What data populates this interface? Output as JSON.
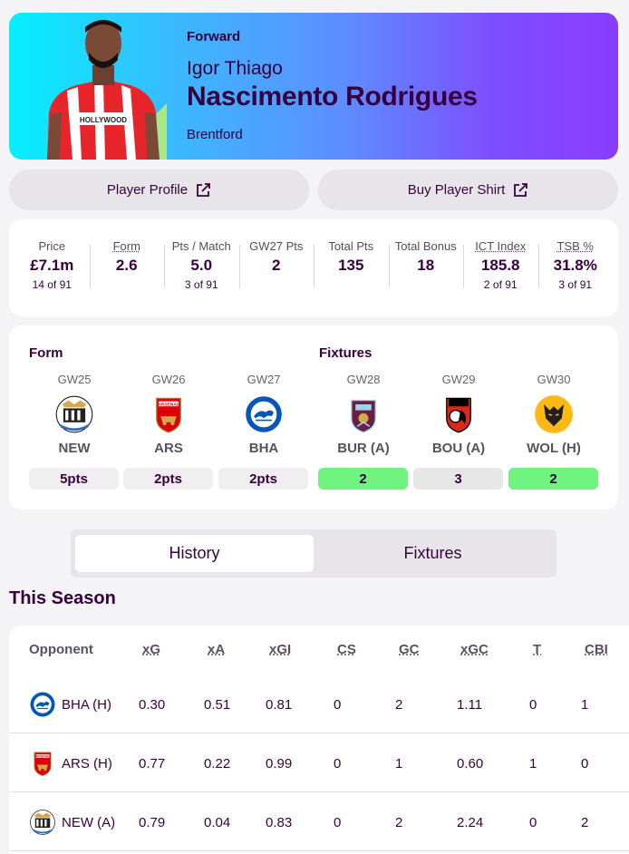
{
  "player": {
    "position": "Forward",
    "first_name": "Igor Thiago",
    "last_name": "Nascimento Rodrigues",
    "team": "Brentford",
    "shirt_sponsor": "HOLLYWOOD"
  },
  "buttons": {
    "profile": "Player Profile",
    "shirt": "Buy Player Shirt"
  },
  "stats": [
    {
      "label": "Price",
      "value": "£7.1m",
      "rank": "14 of 91",
      "underline": false
    },
    {
      "label": "Form",
      "value": "2.6",
      "rank": "",
      "underline": true
    },
    {
      "label": "Pts / Match",
      "value": "5.0",
      "rank": "3 of 91",
      "underline": false
    },
    {
      "label": "GW27 Pts",
      "value": "2",
      "rank": "",
      "underline": false
    },
    {
      "label": "Total Pts",
      "value": "135",
      "rank": "",
      "underline": false
    },
    {
      "label": "Total Bonus",
      "value": "18",
      "rank": "",
      "underline": false
    },
    {
      "label": "ICT Index",
      "value": "185.8",
      "rank": "2 of 91",
      "underline": true
    },
    {
      "label": "TSB %",
      "value": "31.8%",
      "rank": "3 of 91",
      "underline": true
    }
  ],
  "form": {
    "heading": "Form",
    "items": [
      {
        "gw": "GW25",
        "team": "NEW",
        "result": "5pts",
        "crest": "newcastle-crest"
      },
      {
        "gw": "GW26",
        "team": "ARS",
        "result": "2pts",
        "crest": "arsenal-crest"
      },
      {
        "gw": "GW27",
        "team": "BHA",
        "result": "2pts",
        "crest": "brighton-crest"
      }
    ]
  },
  "fixtures": {
    "heading": "Fixtures",
    "items": [
      {
        "gw": "GW28",
        "team": "BUR (A)",
        "difficulty": "2",
        "crest": "burnley-crest",
        "color": "#6ef47f"
      },
      {
        "gw": "GW29",
        "team": "BOU (A)",
        "difficulty": "3",
        "crest": "bournemouth-crest",
        "color": "#e7e7e7"
      },
      {
        "gw": "GW30",
        "team": "WOL (H)",
        "difficulty": "2",
        "crest": "wolves-crest",
        "color": "#6ef47f"
      }
    ]
  },
  "tabs": {
    "history": "History",
    "fixtures": "Fixtures",
    "active": "History"
  },
  "season_title": "This Season",
  "table": {
    "headers": [
      "Opponent",
      "xG",
      "xA",
      "xGI",
      "CS",
      "GC",
      "xGC",
      "T",
      "CBI"
    ],
    "rows": [
      {
        "crest": "brighton-crest",
        "opponent": "BHA (H)",
        "cells": [
          "0.30",
          "0.51",
          "0.81",
          "0",
          "2",
          "1.11",
          "0",
          "1"
        ]
      },
      {
        "crest": "arsenal-crest",
        "opponent": "ARS (H)",
        "cells": [
          "0.77",
          "0.22",
          "0.99",
          "0",
          "1",
          "0.60",
          "1",
          "0"
        ]
      },
      {
        "crest": "newcastle-crest",
        "opponent": "NEW (A)",
        "cells": [
          "0.79",
          "0.04",
          "0.83",
          "0",
          "2",
          "2.24",
          "0",
          "2"
        ]
      }
    ]
  },
  "colors": {
    "brand": "#37003c",
    "green": "#6ef47f",
    "grey_pill": "#f0eef1"
  }
}
